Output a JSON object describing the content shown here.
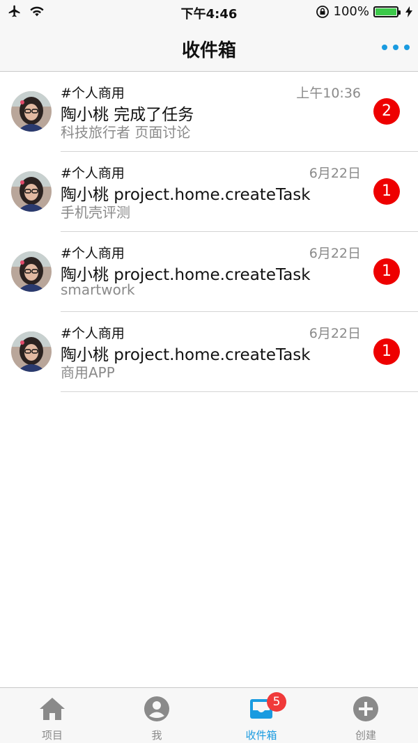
{
  "status_bar": {
    "time": "下午4:46",
    "battery_text": "100%"
  },
  "nav": {
    "title": "收件箱",
    "more_icon": "more-dots-icon",
    "accent_color": "#1a9be0"
  },
  "inbox": [
    {
      "tag": "#个人商用",
      "time": "上午10:36",
      "title": "陶小桃 完成了任务",
      "subtitle": "科技旅行者 页面讨论",
      "badge": "2"
    },
    {
      "tag": "#个人商用",
      "time": "6月22日",
      "title": "陶小桃 project.home.createTask",
      "subtitle": "手机壳评测",
      "badge": "1"
    },
    {
      "tag": "#个人商用",
      "time": "6月22日",
      "title": "陶小桃 project.home.createTask",
      "subtitle": "smartwork",
      "badge": "1"
    },
    {
      "tag": "#个人商用",
      "time": "6月22日",
      "title": "陶小桃 project.home.createTask",
      "subtitle": "商用APP",
      "badge": "1"
    }
  ],
  "tab_bar": {
    "tabs": [
      {
        "label": "项目",
        "icon": "home-icon",
        "active": false
      },
      {
        "label": "我",
        "icon": "person-icon",
        "active": false
      },
      {
        "label": "收件箱",
        "icon": "inbox-icon",
        "active": true,
        "badge": "5"
      },
      {
        "label": "创建",
        "icon": "plus-circle-icon",
        "active": false
      }
    ]
  }
}
